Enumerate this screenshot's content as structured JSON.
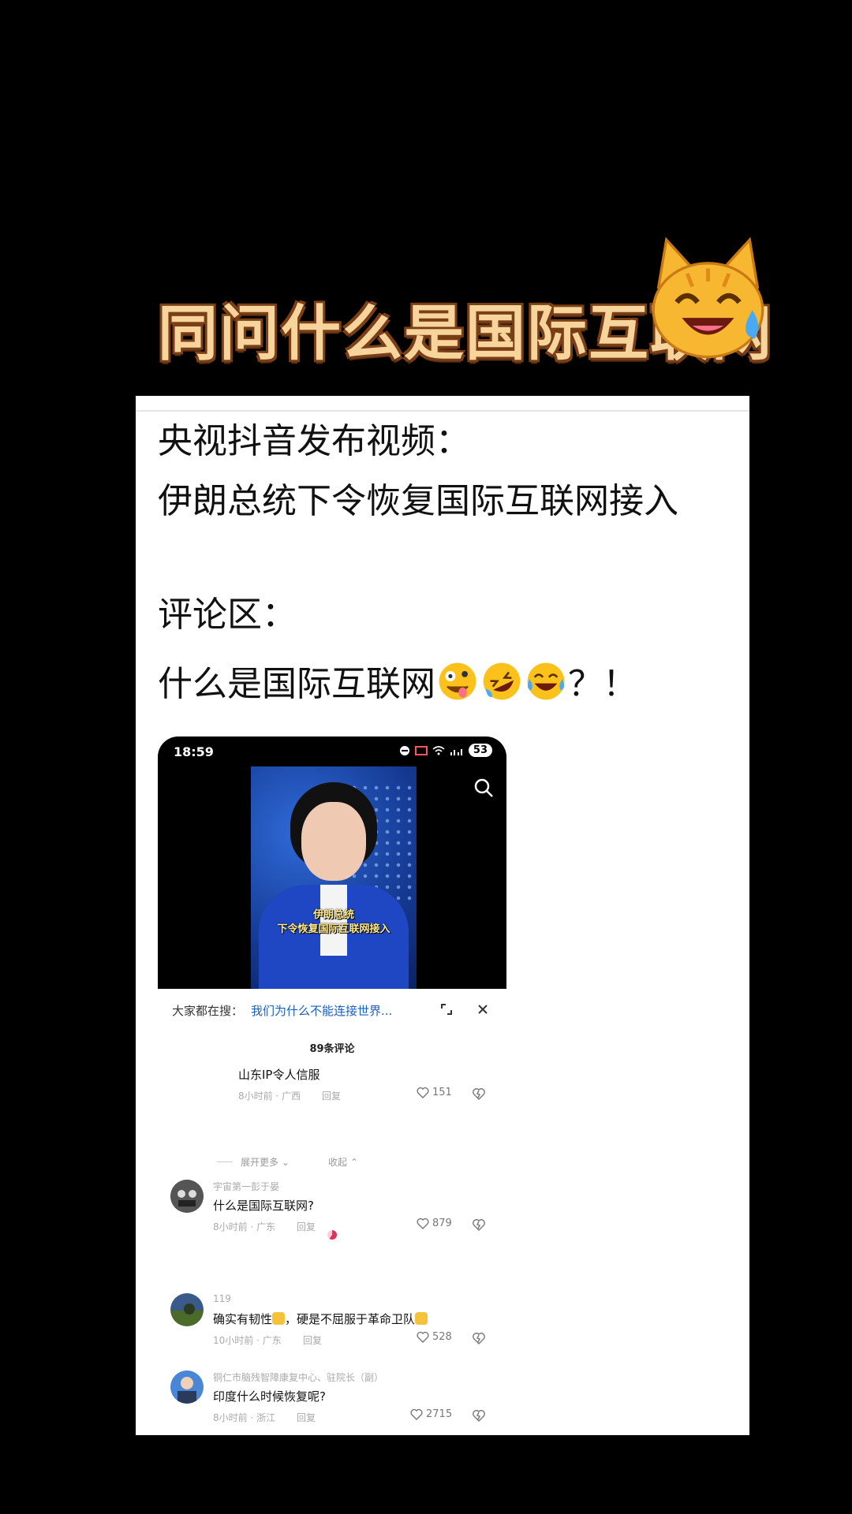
{
  "overlay": {
    "title": "同问什么是国际互联网",
    "cat_emoji": "crying-laughing-cat-icon"
  },
  "post": {
    "line1": "央视抖音发布视频：",
    "line2": "伊朗总统下令恢复国际互联网接入",
    "line3": "评论区：",
    "line4_text": "什么是国际互联网",
    "line4_emojis": [
      "zany-face-icon",
      "rolling-laughing-icon",
      "tears-of-joy-icon"
    ],
    "line4_suffix": "？！"
  },
  "phone": {
    "status": {
      "time": "18:59",
      "battery": "53"
    },
    "video": {
      "subtitle_line1": "伊朗总统",
      "subtitle_line2": "下令恢复国际互联网接入"
    },
    "search": {
      "prefix": "大家都在搜：",
      "query": "我们为什么不能连接世界..."
    },
    "comments_header": "89条评论",
    "reply": {
      "text": "山东IP令人信服",
      "meta": "8小时前 · 广西",
      "reply_label": "回复",
      "likes": "151"
    },
    "expand_more": "展开更多",
    "collapse": "收起",
    "comments": [
      {
        "username": "宇宙第一彭于晏",
        "text": "什么是国际互联网?",
        "meta": "8小时前 · 广东",
        "reply_label": "回复",
        "likes": "879"
      },
      {
        "username": "119",
        "text_a": "确实有韧性",
        "text_b": "，硬是不屈服于革命卫队",
        "meta": "10小时前 · 广东",
        "reply_label": "回复",
        "likes": "528"
      },
      {
        "username": "铜仁市脑残智障康复中心、驻院长（副）",
        "text": "印度什么时候恢复呢?",
        "meta": "8小时前 · 浙江",
        "reply_label": "回复",
        "likes": "2715"
      }
    ]
  }
}
